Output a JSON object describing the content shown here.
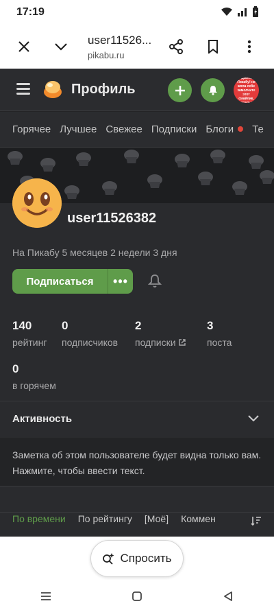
{
  "status_bar": {
    "time": "17:19"
  },
  "browser": {
    "title": "user11526...",
    "url": "pikabu.ru"
  },
  "app": {
    "brand": "Профиль",
    "avatar_text": "Админы Пикабу! не жопа себе замолчите этот смайлик, веселья!",
    "tabs": [
      {
        "label": "Горячее"
      },
      {
        "label": "Лучшее"
      },
      {
        "label": "Свежее"
      },
      {
        "label": "Подписки"
      },
      {
        "label": "Блоги"
      },
      {
        "label": "Те"
      }
    ]
  },
  "profile": {
    "username": "user11526382",
    "since": "На Пикабу 5 месяцев 2 недели 3 дня",
    "subscribe_label": "Подписаться",
    "more_label": "•••",
    "stats": [
      {
        "value": "140",
        "label": "рейтинг"
      },
      {
        "value": "0",
        "label": "подписчиков"
      },
      {
        "value": "2",
        "label": "подписки"
      },
      {
        "value": "3",
        "label": "поста"
      },
      {
        "value": "0",
        "label": "в горячем"
      }
    ],
    "activity_label": "Активность",
    "note": "Заметка об этом пользователе будет видна только вам. Нажмите, чтобы ввести текст.",
    "sorting": [
      {
        "label": "По времени",
        "active": true
      },
      {
        "label": "По рейтингу",
        "active": false
      },
      {
        "label": "[Моё]",
        "active": false
      },
      {
        "label": "Коммен",
        "active": false
      }
    ]
  },
  "bottom": {
    "ask_label": "Спросить"
  },
  "colors": {
    "accent": "#5f9c4a",
    "dark_bg": "#242426",
    "notification_dot": "#e0463a"
  }
}
